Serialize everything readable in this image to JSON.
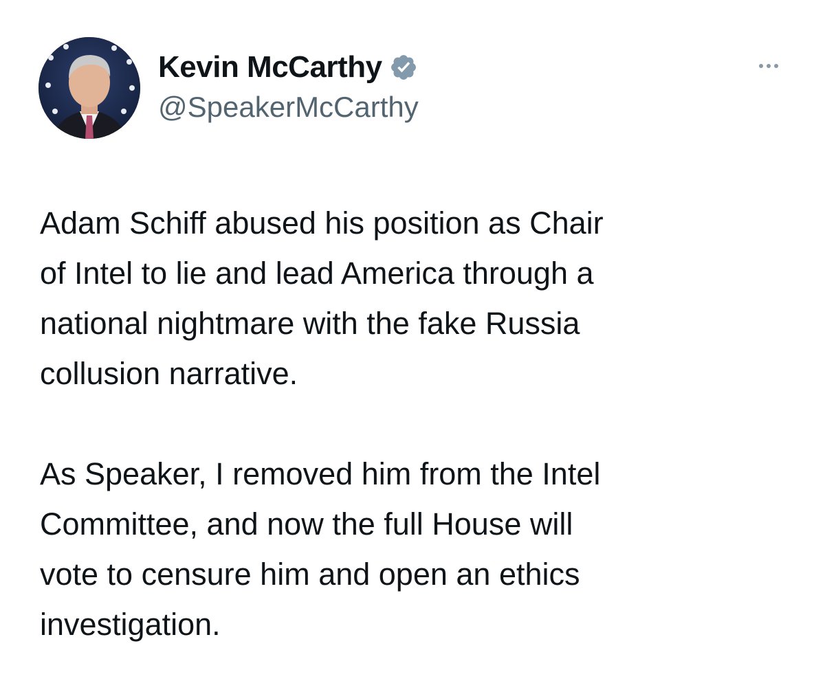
{
  "tweet": {
    "author": {
      "display_name": "Kevin McCarthy",
      "handle": "@SpeakerMcCarthy",
      "verified_icon": "verified-badge-icon",
      "verified_color": "#829aab"
    },
    "more_icon": "more-options-icon",
    "paragraphs": [
      {
        "lines": [
          "Adam Schiff abused his position as Chair",
          "of Intel to lie and lead America through a",
          "national nightmare with the fake Russia",
          "collusion narrative."
        ]
      },
      {
        "lines": [
          "As Speaker, I removed him from the Intel",
          "Committee, and now the full House will",
          "vote to censure him and open an ethics",
          "investigation."
        ]
      }
    ]
  },
  "colors": {
    "text": "#0f1419",
    "secondary": "#536471",
    "background": "#ffffff"
  }
}
